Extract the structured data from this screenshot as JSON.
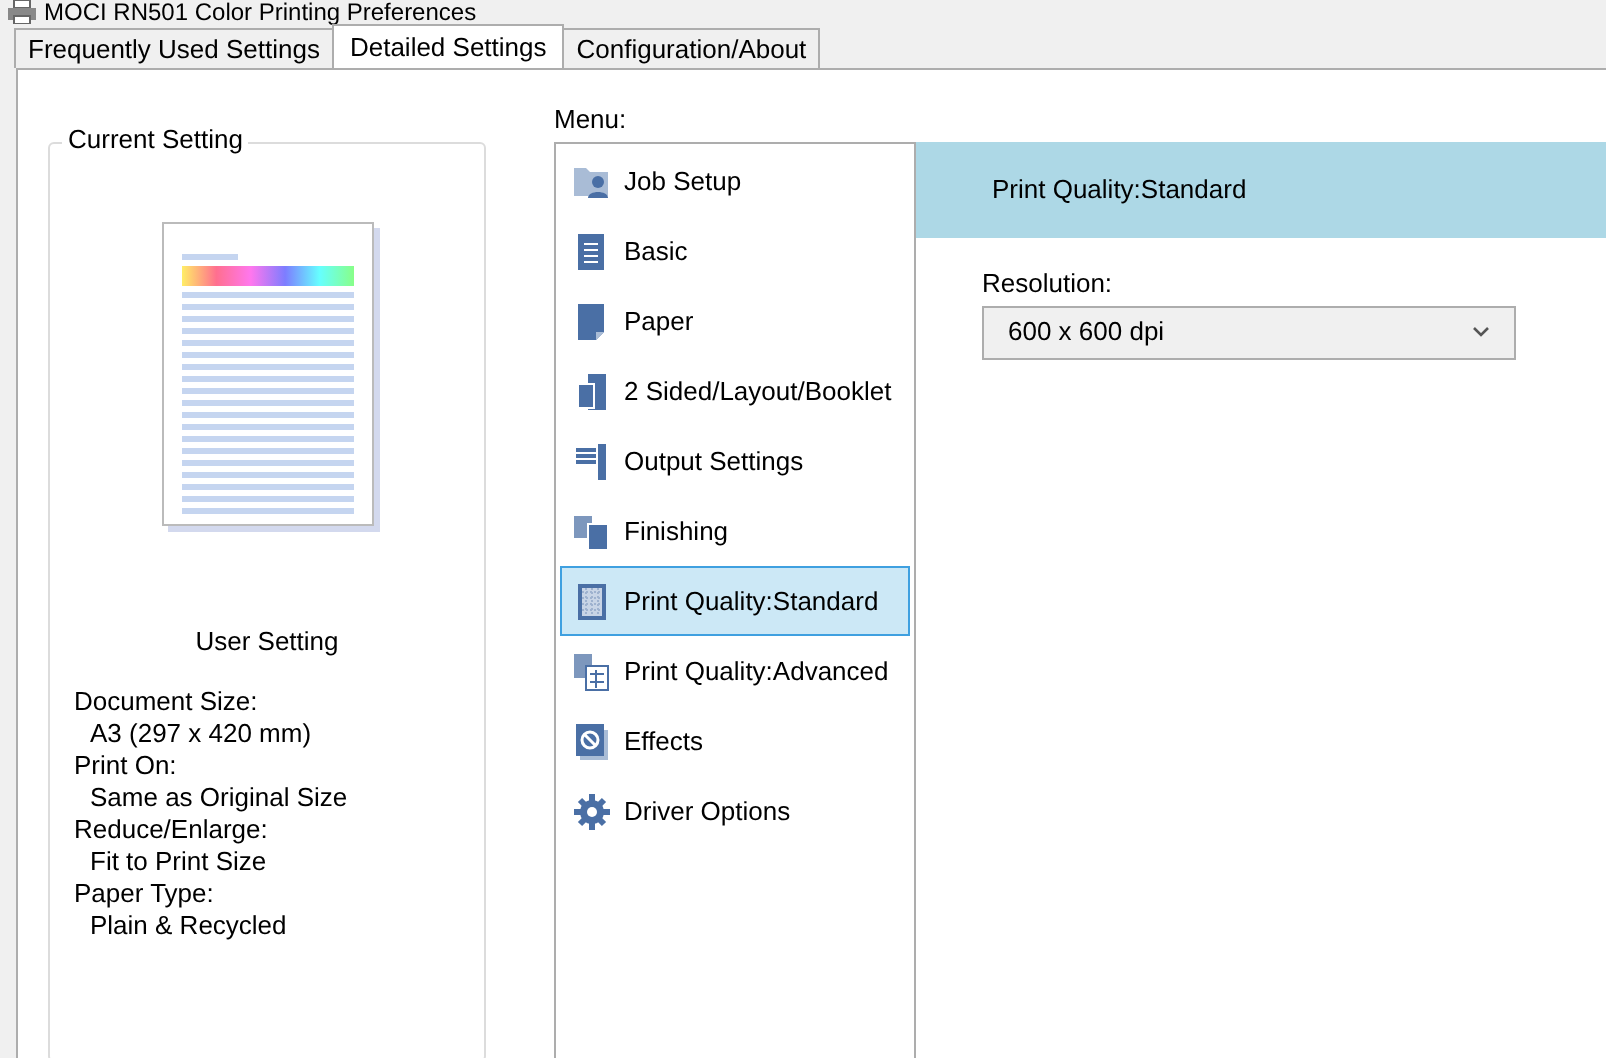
{
  "window": {
    "title": "MOCI RN501 Color Printing Preferences"
  },
  "tabs": [
    {
      "label": "Frequently Used Settings",
      "selected": false
    },
    {
      "label": "Detailed Settings",
      "selected": true
    },
    {
      "label": "Configuration/About",
      "selected": false
    }
  ],
  "current_setting": {
    "title": "Current Setting",
    "preview_caption": "User Setting",
    "details": [
      {
        "label": "Document Size:",
        "value": "A3 (297 x 420 mm)"
      },
      {
        "label": "Print On:",
        "value": "Same as Original Size"
      },
      {
        "label": "Reduce/Enlarge:",
        "value": "Fit to Print Size"
      },
      {
        "label": "Paper Type:",
        "value": "Plain & Recycled"
      }
    ]
  },
  "menu": {
    "label": "Menu:",
    "items": [
      {
        "label": "Job Setup",
        "kind": "job",
        "selected": false
      },
      {
        "label": "Basic",
        "kind": "basic",
        "selected": false
      },
      {
        "label": "Paper",
        "kind": "paper",
        "selected": false
      },
      {
        "label": "2 Sided/Layout/Booklet",
        "kind": "layout",
        "selected": false
      },
      {
        "label": "Output Settings",
        "kind": "output",
        "selected": false
      },
      {
        "label": "Finishing",
        "kind": "finishing",
        "selected": false
      },
      {
        "label": "Print Quality:Standard",
        "kind": "quality",
        "selected": true
      },
      {
        "label": "Print Quality:Advanced",
        "kind": "advanced",
        "selected": false
      },
      {
        "label": "Effects",
        "kind": "effects",
        "selected": false
      },
      {
        "label": "Driver Options",
        "kind": "gear",
        "selected": false
      }
    ]
  },
  "panel": {
    "header": "Print Quality:Standard",
    "resolution": {
      "label": "Resolution:",
      "value": "600 x 600 dpi"
    }
  }
}
